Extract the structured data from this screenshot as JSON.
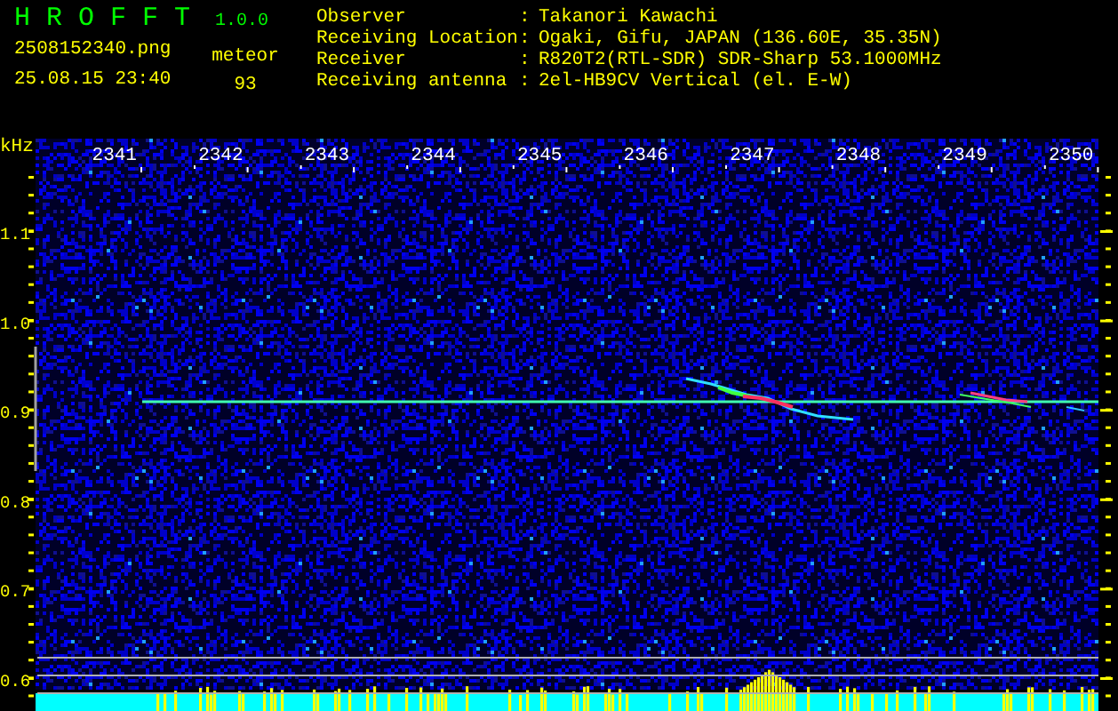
{
  "app": {
    "name": "H R O F F T",
    "version": "1.0.0"
  },
  "file_name": "2508152340.png",
  "timestamp": "25.08.15 23:40",
  "detection": {
    "label": "meteor",
    "count": "93"
  },
  "info": [
    {
      "label": "Observer",
      "separator": ":",
      "value": "Takanori Kawachi"
    },
    {
      "label": "Receiving Location",
      "separator": ":",
      "value": "Ogaki, Gifu, JAPAN (136.60E, 35.35N)"
    },
    {
      "label": "Receiver",
      "separator": ":",
      "value": "R820T2(RTL-SDR) SDR-Sharp 53.1000MHz"
    },
    {
      "label": "Receiving antenna",
      "separator": ":",
      "value": "2el-HB9CV Vertical (el. E-W)"
    }
  ],
  "plot": {
    "y_unit": "kHz",
    "x_labels": [
      "2341",
      "2342",
      "2343",
      "2344",
      "2345",
      "2346",
      "2347",
      "2348",
      "2349",
      "2350"
    ],
    "y_labels": [
      "1.1",
      "1.0",
      "0.9",
      "0.8",
      "0.7",
      "0.6"
    ]
  }
}
